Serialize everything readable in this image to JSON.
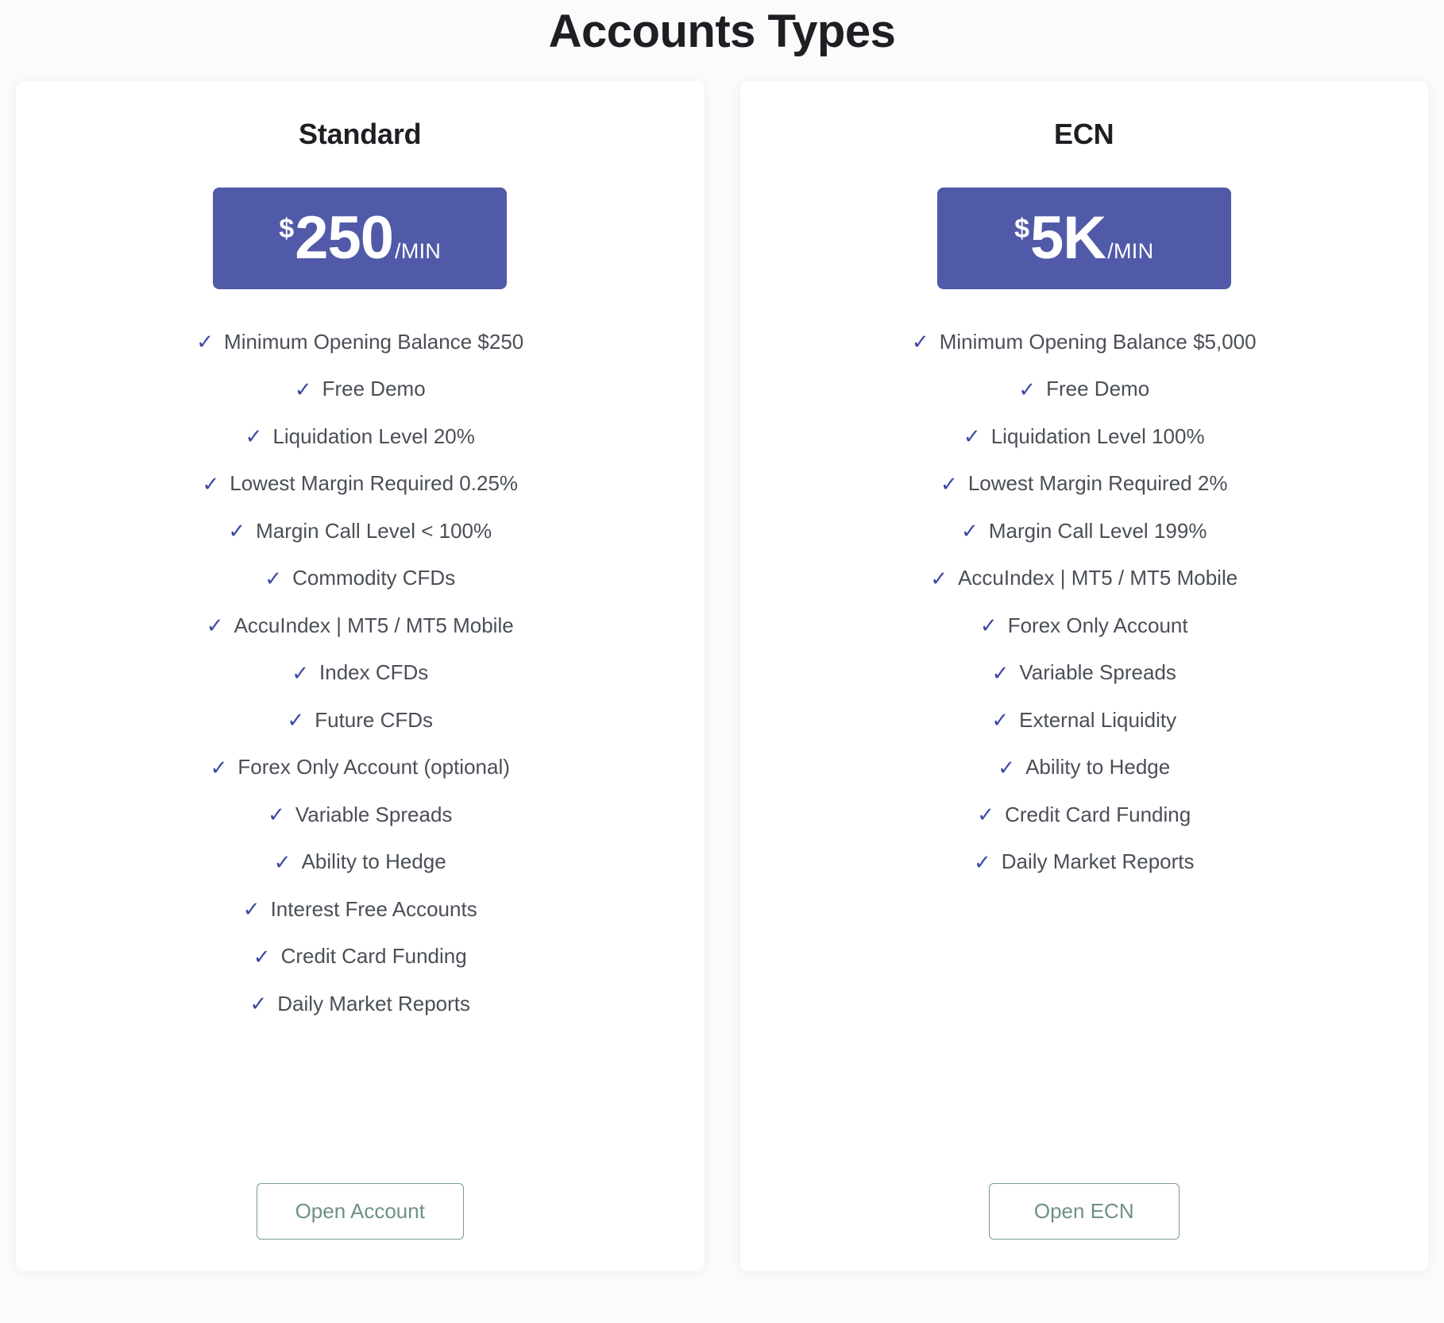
{
  "page": {
    "title": "Accounts Types"
  },
  "cards": [
    {
      "name": "Standard",
      "price": {
        "currency": "$",
        "amount": "250",
        "period": "/MIN"
      },
      "features": [
        "Minimum Opening Balance $250",
        "Free Demo",
        "Liquidation Level 20%",
        "Lowest Margin Required 0.25%",
        "Margin Call Level < 100%",
        "Commodity CFDs",
        "AccuIndex | MT5 / MT5 Mobile",
        "Index CFDs",
        "Future CFDs",
        "Forex Only Account (optional)",
        "Variable Spreads",
        "Ability to Hedge",
        "Interest Free Accounts",
        "Credit Card Funding",
        "Daily Market Reports"
      ],
      "cta_label": "Open Account",
      "check_glyph": "✓"
    },
    {
      "name": "ECN",
      "price": {
        "currency": "$",
        "amount": "5K",
        "period": "/MIN"
      },
      "features": [
        "Minimum Opening Balance $5,000",
        "Free Demo",
        "Liquidation Level 100%",
        "Lowest Margin Required 2%",
        "Margin Call Level 199%",
        "AccuIndex | MT5 / MT5 Mobile",
        "Forex Only Account",
        "Variable Spreads",
        "External Liquidity",
        "Ability to Hedge",
        "Credit Card Funding",
        "Daily Market Reports"
      ],
      "cta_label": "Open ECN",
      "check_glyph": "✓"
    }
  ],
  "colors": {
    "badge_background": "#505aa8",
    "check_mark": "#3d4aa2",
    "cta_border": "#7a9d90",
    "cta_text": "#6e9185",
    "title_text": "#1d1f23",
    "feature_text": "#4a4f57",
    "page_background": "#fbfbfc",
    "card_background": "#ffffff"
  }
}
